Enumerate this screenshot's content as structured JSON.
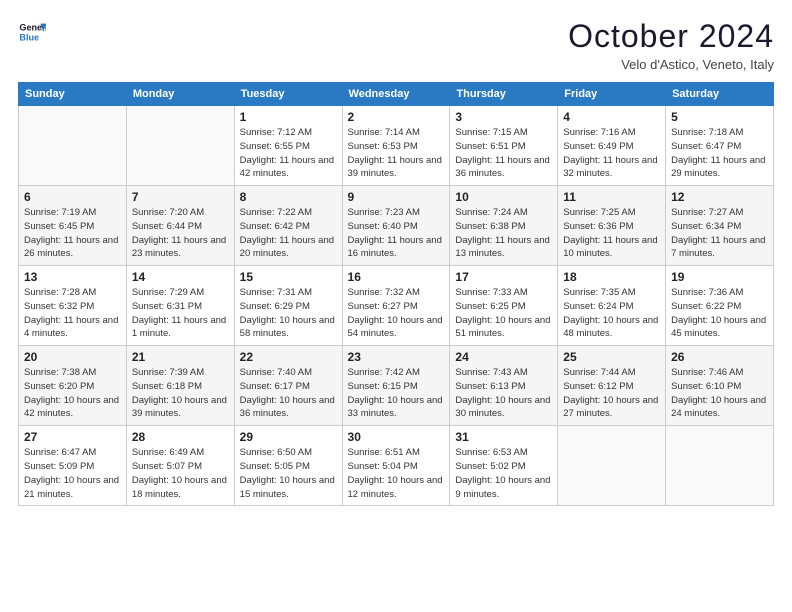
{
  "header": {
    "title": "October 2024",
    "location": "Velo d'Astico, Veneto, Italy"
  },
  "days": [
    "Sunday",
    "Monday",
    "Tuesday",
    "Wednesday",
    "Thursday",
    "Friday",
    "Saturday"
  ],
  "weeks": [
    [
      {
        "num": "",
        "detail": ""
      },
      {
        "num": "",
        "detail": ""
      },
      {
        "num": "1",
        "detail": "Sunrise: 7:12 AM\nSunset: 6:55 PM\nDaylight: 11 hours and 42 minutes."
      },
      {
        "num": "2",
        "detail": "Sunrise: 7:14 AM\nSunset: 6:53 PM\nDaylight: 11 hours and 39 minutes."
      },
      {
        "num": "3",
        "detail": "Sunrise: 7:15 AM\nSunset: 6:51 PM\nDaylight: 11 hours and 36 minutes."
      },
      {
        "num": "4",
        "detail": "Sunrise: 7:16 AM\nSunset: 6:49 PM\nDaylight: 11 hours and 32 minutes."
      },
      {
        "num": "5",
        "detail": "Sunrise: 7:18 AM\nSunset: 6:47 PM\nDaylight: 11 hours and 29 minutes."
      }
    ],
    [
      {
        "num": "6",
        "detail": "Sunrise: 7:19 AM\nSunset: 6:45 PM\nDaylight: 11 hours and 26 minutes."
      },
      {
        "num": "7",
        "detail": "Sunrise: 7:20 AM\nSunset: 6:44 PM\nDaylight: 11 hours and 23 minutes."
      },
      {
        "num": "8",
        "detail": "Sunrise: 7:22 AM\nSunset: 6:42 PM\nDaylight: 11 hours and 20 minutes."
      },
      {
        "num": "9",
        "detail": "Sunrise: 7:23 AM\nSunset: 6:40 PM\nDaylight: 11 hours and 16 minutes."
      },
      {
        "num": "10",
        "detail": "Sunrise: 7:24 AM\nSunset: 6:38 PM\nDaylight: 11 hours and 13 minutes."
      },
      {
        "num": "11",
        "detail": "Sunrise: 7:25 AM\nSunset: 6:36 PM\nDaylight: 11 hours and 10 minutes."
      },
      {
        "num": "12",
        "detail": "Sunrise: 7:27 AM\nSunset: 6:34 PM\nDaylight: 11 hours and 7 minutes."
      }
    ],
    [
      {
        "num": "13",
        "detail": "Sunrise: 7:28 AM\nSunset: 6:32 PM\nDaylight: 11 hours and 4 minutes."
      },
      {
        "num": "14",
        "detail": "Sunrise: 7:29 AM\nSunset: 6:31 PM\nDaylight: 11 hours and 1 minute."
      },
      {
        "num": "15",
        "detail": "Sunrise: 7:31 AM\nSunset: 6:29 PM\nDaylight: 10 hours and 58 minutes."
      },
      {
        "num": "16",
        "detail": "Sunrise: 7:32 AM\nSunset: 6:27 PM\nDaylight: 10 hours and 54 minutes."
      },
      {
        "num": "17",
        "detail": "Sunrise: 7:33 AM\nSunset: 6:25 PM\nDaylight: 10 hours and 51 minutes."
      },
      {
        "num": "18",
        "detail": "Sunrise: 7:35 AM\nSunset: 6:24 PM\nDaylight: 10 hours and 48 minutes."
      },
      {
        "num": "19",
        "detail": "Sunrise: 7:36 AM\nSunset: 6:22 PM\nDaylight: 10 hours and 45 minutes."
      }
    ],
    [
      {
        "num": "20",
        "detail": "Sunrise: 7:38 AM\nSunset: 6:20 PM\nDaylight: 10 hours and 42 minutes."
      },
      {
        "num": "21",
        "detail": "Sunrise: 7:39 AM\nSunset: 6:18 PM\nDaylight: 10 hours and 39 minutes."
      },
      {
        "num": "22",
        "detail": "Sunrise: 7:40 AM\nSunset: 6:17 PM\nDaylight: 10 hours and 36 minutes."
      },
      {
        "num": "23",
        "detail": "Sunrise: 7:42 AM\nSunset: 6:15 PM\nDaylight: 10 hours and 33 minutes."
      },
      {
        "num": "24",
        "detail": "Sunrise: 7:43 AM\nSunset: 6:13 PM\nDaylight: 10 hours and 30 minutes."
      },
      {
        "num": "25",
        "detail": "Sunrise: 7:44 AM\nSunset: 6:12 PM\nDaylight: 10 hours and 27 minutes."
      },
      {
        "num": "26",
        "detail": "Sunrise: 7:46 AM\nSunset: 6:10 PM\nDaylight: 10 hours and 24 minutes."
      }
    ],
    [
      {
        "num": "27",
        "detail": "Sunrise: 6:47 AM\nSunset: 5:09 PM\nDaylight: 10 hours and 21 minutes."
      },
      {
        "num": "28",
        "detail": "Sunrise: 6:49 AM\nSunset: 5:07 PM\nDaylight: 10 hours and 18 minutes."
      },
      {
        "num": "29",
        "detail": "Sunrise: 6:50 AM\nSunset: 5:05 PM\nDaylight: 10 hours and 15 minutes."
      },
      {
        "num": "30",
        "detail": "Sunrise: 6:51 AM\nSunset: 5:04 PM\nDaylight: 10 hours and 12 minutes."
      },
      {
        "num": "31",
        "detail": "Sunrise: 6:53 AM\nSunset: 5:02 PM\nDaylight: 10 hours and 9 minutes."
      },
      {
        "num": "",
        "detail": ""
      },
      {
        "num": "",
        "detail": ""
      }
    ]
  ]
}
